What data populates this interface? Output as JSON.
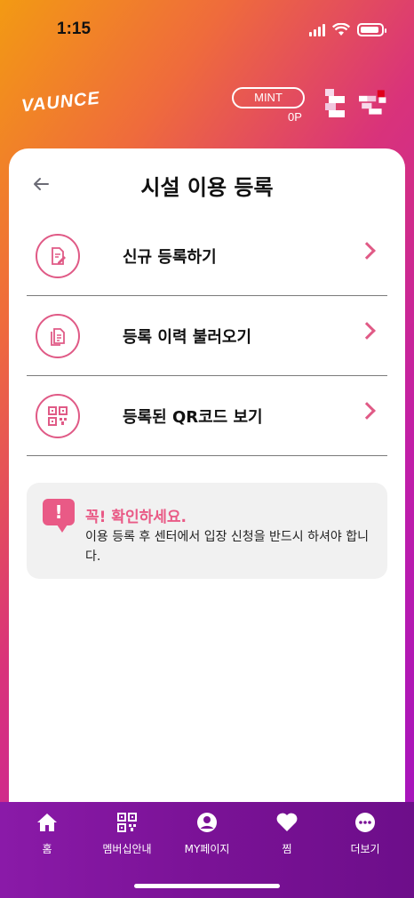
{
  "status": {
    "time": "1:15"
  },
  "header": {
    "logo": "VAUNCE",
    "membership": "MINT",
    "points": "0P"
  },
  "page": {
    "title": "시설 이용 등록"
  },
  "menu": [
    {
      "label": "신규 등록하기",
      "icon": "edit-document-icon"
    },
    {
      "label": "등록 이력 불러오기",
      "icon": "documents-icon"
    },
    {
      "label": "등록된 QR코드 보기",
      "icon": "qr-code-icon"
    }
  ],
  "notice": {
    "title": "꼭! 확인하세요.",
    "body": "이용 등록 후 센터에서 입장 신청을 반드시 하셔야 합니다."
  },
  "tabs": [
    {
      "label": "홈",
      "icon": "home-icon"
    },
    {
      "label": "멤버십안내",
      "icon": "qr-code-icon"
    },
    {
      "label": "MY페이지",
      "icon": "user-icon"
    },
    {
      "label": "찜",
      "icon": "heart-icon"
    },
    {
      "label": "더보기",
      "icon": "more-icon"
    }
  ],
  "colors": {
    "accent": "#e95a86",
    "tabbar": "#7a1296",
    "notice_bg": "#f1f1f1"
  }
}
